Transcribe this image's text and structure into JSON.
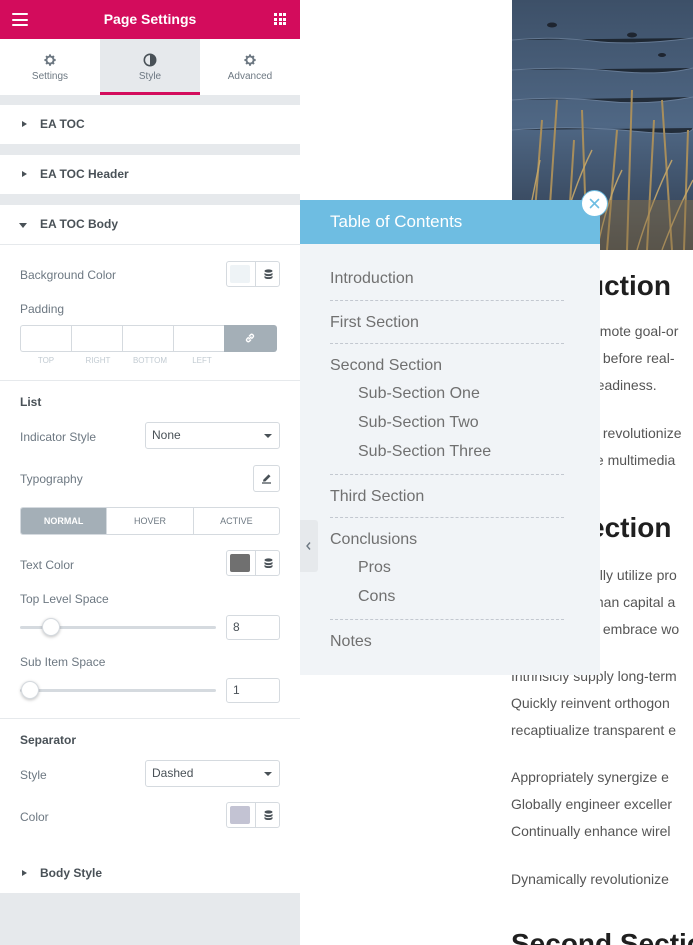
{
  "header": {
    "title": "Page Settings",
    "menu_icon": "hamburger-icon",
    "apps_icon": "grid-icon"
  },
  "tabs": [
    {
      "label": "Settings",
      "icon": "gear-icon"
    },
    {
      "label": "Style",
      "icon": "half-circle-icon",
      "active": true
    },
    {
      "label": "Advanced",
      "icon": "gear-icon"
    }
  ],
  "sections": {
    "ea_toc": "EA TOC",
    "ea_toc_header": "EA TOC Header",
    "ea_toc_body": "EA TOC Body",
    "body_style": "Body Style"
  },
  "toc_body": {
    "background_color_label": "Background Color",
    "background_color": "#eef3f6",
    "padding_label": "Padding",
    "padding_sides": [
      "TOP",
      "RIGHT",
      "BOTTOM",
      "LEFT"
    ],
    "list_heading": "List",
    "indicator_style_label": "Indicator Style",
    "indicator_style_value": "None",
    "typography_label": "Typography",
    "state_tabs": [
      "NORMAL",
      "HOVER",
      "ACTIVE"
    ],
    "text_color_label": "Text Color",
    "text_color": "#707070",
    "top_level_space_label": "Top Level Space",
    "top_level_space_value": "8",
    "sub_item_space_label": "Sub Item Space",
    "sub_item_space_value": "1",
    "separator_heading": "Separator",
    "separator_style_label": "Style",
    "separator_style_value": "Dashed",
    "separator_color_label": "Color",
    "separator_color": "#c3c3d3"
  },
  "colors": {
    "accent": "#d30c5c",
    "toc_header": "#6ebde2",
    "toc_bg": "#f1f4f7"
  },
  "toc": {
    "title": "Table of Contents",
    "items": [
      {
        "label": "Introduction"
      },
      {
        "label": "First Section"
      },
      {
        "label": "Second Section"
      },
      {
        "label": "Sub-Section One"
      },
      {
        "label": "Sub-Section Two"
      },
      {
        "label": "Sub-Section Three"
      },
      {
        "label": "Third Section"
      },
      {
        "label": "Conclusions"
      },
      {
        "label": "Pros"
      },
      {
        "label": "Cons"
      },
      {
        "label": "Notes"
      }
    ]
  },
  "article": {
    "heading_intro": "uction",
    "intro_lines": [
      "omote goal-or",
      "s before real-",
      "readiness."
    ],
    "intro_line2": "y revolutionize",
    "intro_line3": "te multimedia",
    "heading_first": "ection",
    "first_lines": [
      "ally utilize pro",
      "man capital a",
      "y embrace wo"
    ],
    "para2_lines": [
      "Intrinsicly supply long-term",
      "Quickly reinvent orthogon",
      "recaptiualize transparent e"
    ],
    "para3_lines": [
      "Appropriately synergize e",
      "Globally engineer exceller",
      "Continually enhance wirel"
    ],
    "para4": "Dynamically revolutionize",
    "heading_second": "Second Sectio"
  }
}
